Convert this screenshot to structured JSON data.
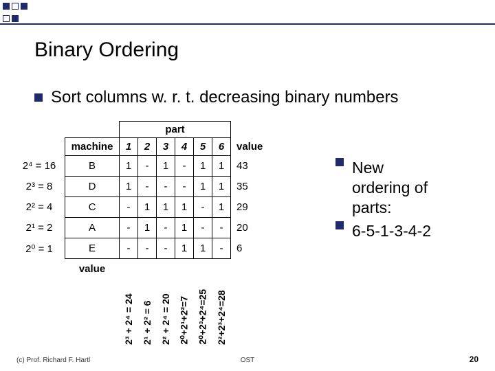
{
  "slide": {
    "title": "Binary Ordering",
    "subtitle": "Sort columns w. r. t. decreasing binary numbers",
    "footer_left": "(c) Prof. Richard F. Hartl",
    "footer_center": "OST",
    "footer_right": "20"
  },
  "table": {
    "part_label": "part",
    "machine_label": "machine",
    "value_label": "value",
    "part_headers": [
      "1",
      "2",
      "3",
      "4",
      "5",
      "6"
    ],
    "row_labels": [
      "2⁴ = 16",
      "2³ = 8",
      "2² = 4",
      "2¹ = 2",
      "2⁰ = 1"
    ],
    "rows": [
      {
        "m": "B",
        "c": [
          "1",
          "-",
          "1",
          "-",
          "1",
          "1"
        ],
        "v": "43"
      },
      {
        "m": "D",
        "c": [
          "1",
          "-",
          "-",
          "-",
          "1",
          "1"
        ],
        "v": "35"
      },
      {
        "m": "C",
        "c": [
          "-",
          "1",
          "1",
          "1",
          "-",
          "1"
        ],
        "v": "29"
      },
      {
        "m": "A",
        "c": [
          "-",
          "1",
          "-",
          "1",
          "-",
          "-"
        ],
        "v": "20"
      },
      {
        "m": "E",
        "c": [
          "-",
          "-",
          "-",
          "1",
          "1",
          "-"
        ],
        "v": "6"
      }
    ],
    "col_value_label": "value",
    "col_values": [
      "2³ + 2⁴ = 24",
      "2¹ + 2² = 6",
      "2² + 2⁴ = 20",
      "2⁰+2¹+2²=7",
      "2⁰+2³+2⁴=25",
      "2²+2³+2⁴=28"
    ]
  },
  "side": {
    "line1a": "New",
    "line1b": "ordering of",
    "line1c": "parts:",
    "line2": "6-5-1-3-4-2"
  },
  "chart_data": {
    "type": "table",
    "title": "Binary Ordering",
    "row_weights": [
      16,
      8,
      4,
      2,
      1
    ],
    "machines": [
      "B",
      "D",
      "C",
      "A",
      "E"
    ],
    "incidence": [
      [
        1,
        0,
        1,
        0,
        1,
        1
      ],
      [
        1,
        0,
        0,
        0,
        1,
        1
      ],
      [
        0,
        1,
        1,
        1,
        0,
        1
      ],
      [
        0,
        1,
        0,
        1,
        0,
        0
      ],
      [
        0,
        0,
        0,
        1,
        1,
        0
      ]
    ],
    "row_values": [
      43,
      35,
      29,
      20,
      6
    ],
    "column_values": [
      24,
      6,
      20,
      7,
      25,
      28
    ],
    "new_part_order": [
      6,
      5,
      1,
      3,
      4,
      2
    ]
  }
}
